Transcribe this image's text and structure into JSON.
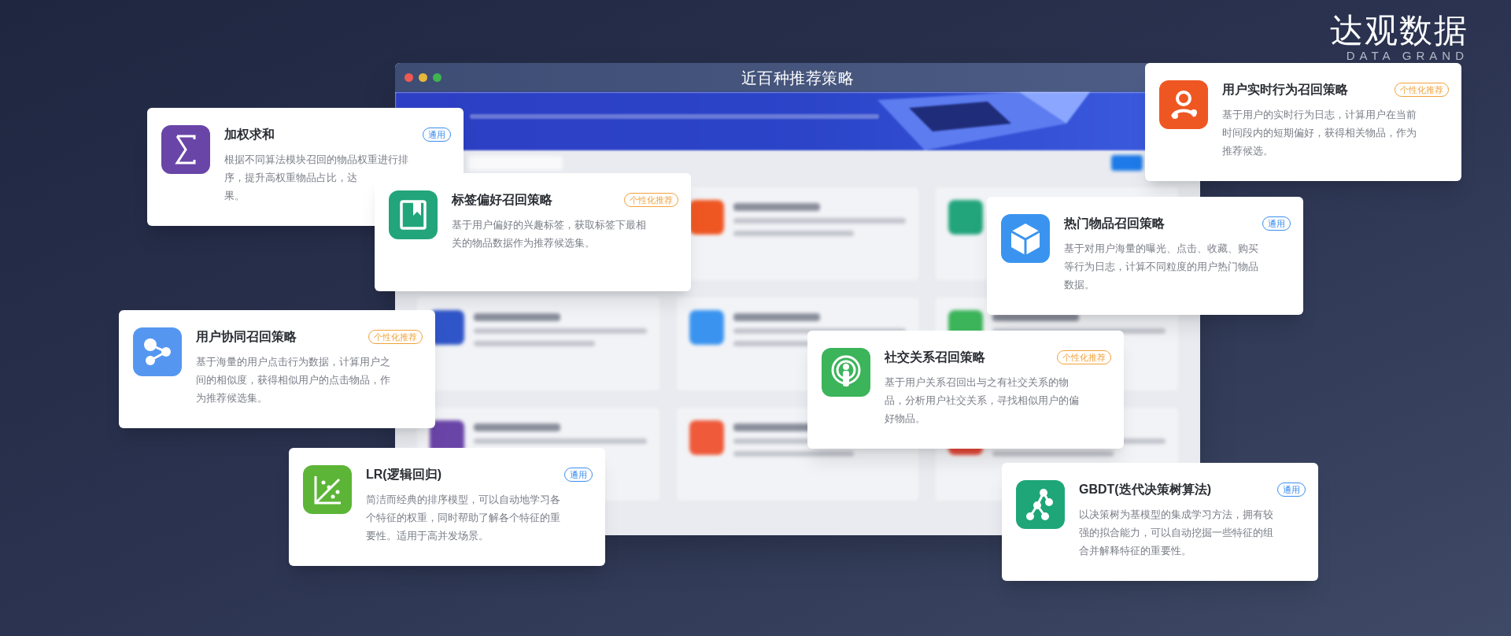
{
  "window": {
    "title": "近百种推荐策略"
  },
  "logo": {
    "name": "达观数据",
    "subtitle": "DATA GRAND"
  },
  "cards": [
    {
      "title": "加权求和",
      "tag": {
        "label": "通用",
        "kind": "general"
      },
      "kind": "sigma",
      "color": "#6a45a8",
      "lines": [
        "根据不同算法模块召回的物品权重进行排",
        "序，提升高权重物品占比，达",
        "果。"
      ]
    },
    {
      "title": "标签偏好召回策略",
      "tag": {
        "label": "个性化推荐",
        "kind": "personal"
      },
      "kind": "bookmark",
      "color": "#22a57a",
      "lines": [
        "基于用户偏好的兴趣标签，获取标签下最相",
        "关的物品数据作为推荐候选集。"
      ]
    },
    {
      "title": "用户实时行为召回策略",
      "tag": {
        "label": "个性化推荐",
        "kind": "personal"
      },
      "kind": "user",
      "color": "#ef5722",
      "lines": [
        "基于用户的实时行为日志，计算用户在当前",
        "时间段内的短期偏好，获得相关物品，作为",
        "推荐候选。"
      ]
    },
    {
      "title": "热门物品召回策略",
      "tag": {
        "label": "通用",
        "kind": "general"
      },
      "kind": "cube",
      "color": "#3a94ef",
      "lines": [
        "基于对用户海量的曝光、点击、收藏、购买",
        "等行为日志，计算不同粒度的用户热门物品",
        "数据。"
      ]
    },
    {
      "title": "用户协同召回策略",
      "tag": {
        "label": "个性化推荐",
        "kind": "personal"
      },
      "kind": "share",
      "color": "#5597f0",
      "lines": [
        "基于海量的用户点击行为数据，计算用户之",
        "间的相似度，获得相似用户的点击物品，作",
        "为推荐候选集。"
      ]
    },
    {
      "title": "社交关系召回策略",
      "tag": {
        "label": "个性化推荐",
        "kind": "personal"
      },
      "kind": "broadcast",
      "color": "#3bb45a",
      "lines": [
        "基于用户关系召回出与之有社交关系的物",
        "品，分析用户社交关系，寻找相似用户的偏",
        "好物品。"
      ]
    },
    {
      "title": "LR(逻辑回归)",
      "tag": {
        "label": "通用",
        "kind": "general"
      },
      "kind": "scatter",
      "color": "#5cb536",
      "lines": [
        "简洁而经典的排序模型，可以自动地学习各",
        "个特征的权重，同时帮助了解各个特征的重",
        "要性。适用于高并发场景。"
      ]
    },
    {
      "title": "GBDT(迭代决策树算法)",
      "tag": {
        "label": "通用",
        "kind": "general"
      },
      "kind": "tree",
      "color": "#1ea679",
      "lines": [
        "以决策树为基模型的集成学习方法，拥有较",
        "强的拟合能力，可以自动挖掘一些特征的组",
        "合并解释特征的重要性。"
      ]
    }
  ]
}
